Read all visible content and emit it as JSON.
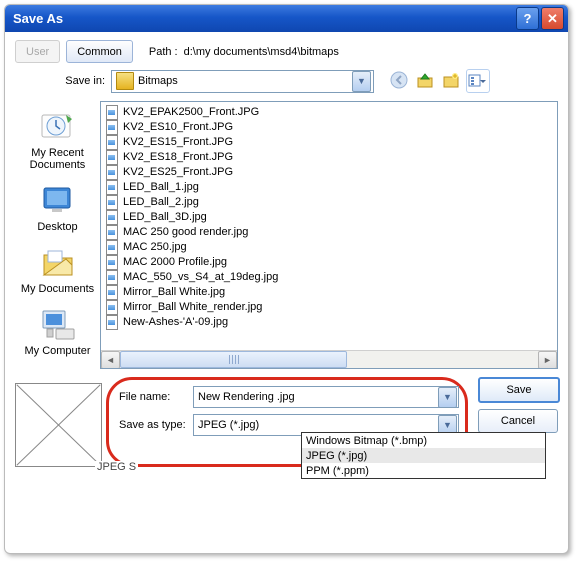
{
  "title": "Save As",
  "toolbar": {
    "user": "User",
    "common": "Common",
    "path_label": "Path :",
    "path_value": "d:\\my documents\\msd4\\bitmaps"
  },
  "save_in": {
    "label": "Save in:",
    "value": "Bitmaps"
  },
  "nav_icons": {
    "back": "back-icon",
    "up": "up-icon",
    "newfolder": "new-folder-icon",
    "view": "view-menu-icon"
  },
  "places": {
    "recent": "My Recent Documents",
    "desktop": "Desktop",
    "mydocs": "My Documents",
    "mycomputer": "My Computer"
  },
  "files": [
    "KV2_EPAK2500_Front.JPG",
    "KV2_ES10_Front.JPG",
    "KV2_ES15_Front.JPG",
    "KV2_ES18_Front.JPG",
    "KV2_ES25_Front.JPG",
    "LED_Ball_1.jpg",
    "LED_Ball_2.jpg",
    "LED_Ball_3D.jpg",
    "MAC 250 good render.jpg",
    "MAC 250.jpg",
    "MAC 2000 Profile.jpg",
    "MAC_550_vs_S4_at_19deg.jpg",
    "Mirror_Ball White.jpg",
    "Mirror_Ball White_render.jpg",
    "New-Ashes-'A'-09.jpg"
  ],
  "filename": {
    "label": "File name:",
    "value": "New Rendering .jpg"
  },
  "savetype": {
    "label": "Save as type:",
    "value": "JPEG (*.jpg)"
  },
  "type_options": [
    "Windows Bitmap (*.bmp)",
    "JPEG (*.jpg)",
    "PPM (*.ppm)"
  ],
  "jpeg_settings_label": "JPEG S",
  "buttons": {
    "save": "Save",
    "cancel": "Cancel"
  },
  "colors": {
    "highlight": "#d92a1c"
  }
}
